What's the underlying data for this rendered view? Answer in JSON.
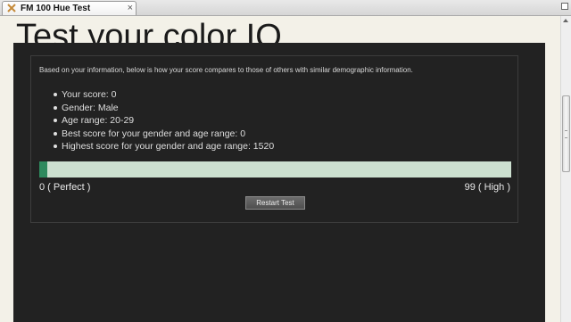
{
  "tab": {
    "title": "FM 100 Hue Test",
    "close_glyph": "×"
  },
  "page": {
    "title": "Test your color IQ"
  },
  "results": {
    "intro": "Based on your information, below is how your score compares to those of others with similar demographic information.",
    "stats": [
      "Your score: 0",
      "Gender: Male",
      "Age range: 20-29",
      "Best score for your gender and age range: 0",
      "Highest score for your gender and age range: 1520"
    ],
    "score_bar": {
      "fill_fraction": 0.017,
      "fill_color": "#2e8a5e",
      "track_color": "#cce0d0"
    },
    "scale_min_label": "0 ( Perfect )",
    "scale_max_label": "99 ( High )",
    "restart_label": "Restart Test"
  },
  "colors": {
    "panel": "#222222",
    "page_background": "#f3f1e8"
  },
  "icons": {
    "tab_icon": "close-x-icon",
    "bullet": "bullet-icon"
  }
}
